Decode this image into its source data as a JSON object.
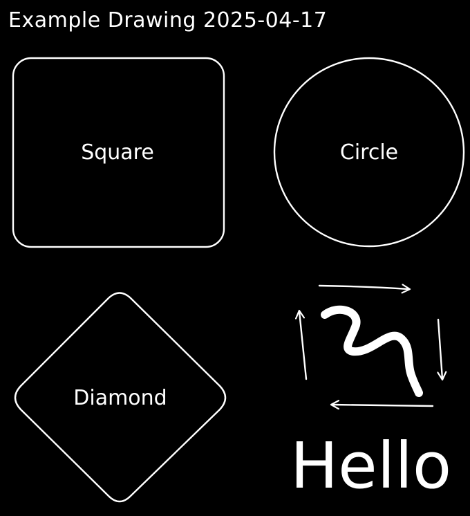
{
  "canvas": {
    "title": "Example Drawing 2025-04-17",
    "background": "#000000",
    "stroke_color": "#ffffff"
  },
  "shapes": {
    "square_label": "Square",
    "circle_label": "Circle",
    "diamond_label": "Diamond",
    "hello_text": "Hello"
  },
  "icons": {
    "arrows": [
      "arrow-right-icon",
      "arrow-down-icon",
      "arrow-left-icon",
      "arrow-up-icon"
    ],
    "squiggle": "freehand-squiggle-icon"
  }
}
